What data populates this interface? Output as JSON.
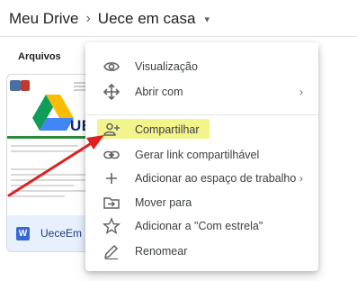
{
  "breadcrumb": {
    "root": "Meu Drive",
    "separator": "›",
    "current": "Uece em casa",
    "caret": "▾"
  },
  "section": {
    "title": "Arquivos"
  },
  "file": {
    "name": "UeceEm",
    "type_badge": "W",
    "thumbnail_brand": "UE",
    "badge_color": "#3568d4"
  },
  "menu": {
    "items": [
      {
        "label": "Visualização",
        "icon": "eye-icon"
      },
      {
        "label": "Abrir com",
        "icon": "open-with-icon",
        "chevron": "›"
      },
      {
        "label": "Compartilhar",
        "icon": "person-add-icon"
      },
      {
        "label": "Gerar link compartilhável",
        "icon": "link-icon"
      },
      {
        "label": "Adicionar ao espaço de trabalho",
        "icon": "plus-icon",
        "chevron": "›"
      },
      {
        "label": "Mover para",
        "icon": "move-to-folder-icon"
      },
      {
        "label": "Adicionar a \"Com estrela\"",
        "icon": "star-outline-icon"
      },
      {
        "label": "Renomear",
        "icon": "pencil-icon"
      }
    ],
    "highlight_color": "#f2f58c"
  },
  "annotation": {
    "arrow_color": "#e02020"
  }
}
